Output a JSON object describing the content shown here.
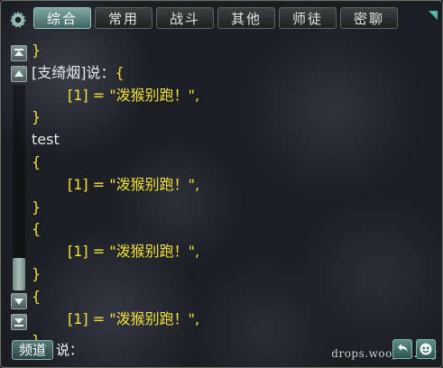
{
  "tabs": [
    {
      "label": "综合",
      "active": true
    },
    {
      "label": "常用",
      "active": false
    },
    {
      "label": "战斗",
      "active": false
    },
    {
      "label": "其他",
      "active": false
    },
    {
      "label": "师徒",
      "active": false
    },
    {
      "label": "密聊",
      "active": false
    }
  ],
  "chat_log": {
    "lines": [
      {
        "text": "}",
        "color": "yellow",
        "indent": false
      },
      {
        "text": "[支绮烟]说：{",
        "color": "mixed",
        "indent": false
      },
      {
        "text": "[1] = \"泼猴别跑！\",",
        "color": "yellow",
        "indent": true
      },
      {
        "text": "}",
        "color": "yellow",
        "indent": false
      },
      {
        "text": "test",
        "color": "white",
        "indent": false
      },
      {
        "text": "{",
        "color": "yellow",
        "indent": false
      },
      {
        "text": "[1] = \"泼猴别跑！\",",
        "color": "yellow",
        "indent": true
      },
      {
        "text": "}",
        "color": "yellow",
        "indent": false
      },
      {
        "text": "{",
        "color": "yellow",
        "indent": false
      },
      {
        "text": "[1] = \"泼猴别跑！\",",
        "color": "yellow",
        "indent": true
      },
      {
        "text": "}",
        "color": "yellow",
        "indent": false
      },
      {
        "text": "{",
        "color": "yellow",
        "indent": false
      },
      {
        "text": "[1] = \"泼猴别跑！\",",
        "color": "yellow",
        "indent": true
      },
      {
        "text": "}",
        "color": "yellow",
        "indent": false
      }
    ],
    "speaker_prefix": "[支绮烟]说：",
    "speaker_suffix": "{"
  },
  "bottom": {
    "channel_label": "频道",
    "say_label": "说：",
    "input_value": "",
    "watermark": "drops.wooyun.org"
  },
  "colors": {
    "chat_yellow": "#f2e23a",
    "chat_white": "#e8e8e8",
    "tab_active": "#5f8a86",
    "accent_teal": "#4fb8a6"
  },
  "icons": [
    "gear-icon",
    "scroll-top-icon",
    "scroll-up-icon",
    "scroll-down-icon",
    "scroll-bottom-icon",
    "reply-icon",
    "emote-icon"
  ]
}
